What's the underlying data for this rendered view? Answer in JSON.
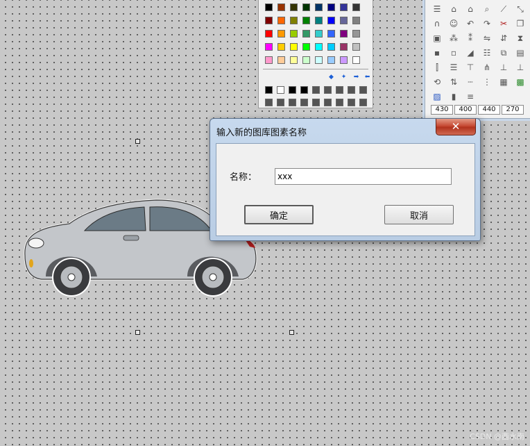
{
  "palette": {
    "rows": [
      [
        "#000000",
        "#993300",
        "#333300",
        "#003300",
        "#003366",
        "#000080",
        "#333399",
        "#333333"
      ],
      [
        "#800000",
        "#ff6600",
        "#808000",
        "#008000",
        "#008080",
        "#0000ff",
        "#666699",
        "#808080"
      ],
      [
        "#ff0000",
        "#ff9900",
        "#99cc00",
        "#339966",
        "#33cccc",
        "#3366ff",
        "#800080",
        "#969696"
      ],
      [
        "#ff00ff",
        "#ffcc00",
        "#ffff00",
        "#00ff00",
        "#00ffff",
        "#00ccff",
        "#993366",
        "#c0c0c0"
      ],
      [
        "#ff99cc",
        "#ffcc99",
        "#ffff99",
        "#ccffcc",
        "#ccffff",
        "#99ccff",
        "#cc99ff",
        "#ffffff"
      ]
    ],
    "custom_row1": [
      "#000000",
      "#ffffff",
      "#000000",
      "#000000",
      "#555555",
      "#555555",
      "#555555",
      "#555555",
      "#555555"
    ],
    "custom_row2": [
      "#555555",
      "#555555",
      "#555555",
      "#555555",
      "#555555",
      "#555555",
      "#555555",
      "#555555",
      "#555555"
    ]
  },
  "tools": {
    "icons": [
      [
        "align-icon",
        "select-icon",
        "home-icon",
        "zoom-icon",
        "polyline-icon",
        "scale-icon"
      ],
      [
        "magnet-icon",
        "person-icon",
        "undo-icon",
        "redo-icon",
        "cut-icon",
        "copy-icon"
      ],
      [
        "paste-icon",
        "group-icon",
        "ungroup-icon",
        "flip-h-icon",
        "flip-v-icon",
        "mirror-icon"
      ],
      [
        "front-icon",
        "back-icon",
        "fill-icon",
        "layer-icon",
        "duplicate-icon",
        "stack-icon"
      ],
      [
        "align-left-icon",
        "align-center-icon",
        "align-top-icon",
        "distribute-icon",
        "space-icon",
        "align-bottom-icon"
      ],
      [
        "rotate-icon",
        "order-icon",
        "dash-line-icon",
        "dot-line-icon",
        "grid-icon",
        "color-grid-icon"
      ],
      [
        "image-icon",
        "gradient-icon",
        "line-weight-icon"
      ]
    ],
    "coords": [
      "430",
      "400",
      "440",
      "270"
    ]
  },
  "dialog": {
    "title": "输入新的图库图素名称",
    "close_symbol": "✕",
    "name_label": "名称：",
    "name_value": "xxx",
    "ok_label": "确定",
    "cancel_label": "取消"
  },
  "watermark": "CSDN @酉水南"
}
